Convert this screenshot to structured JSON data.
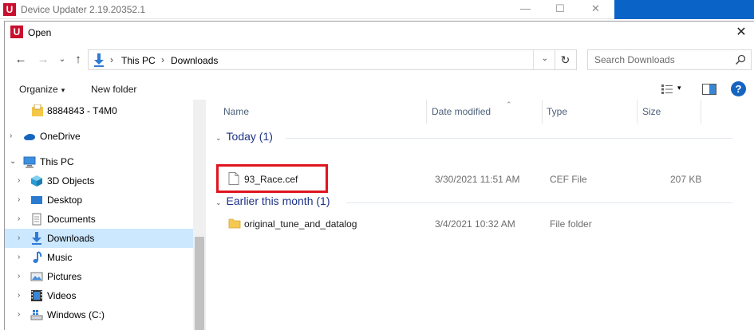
{
  "background_window": {
    "title": "Device Updater 2.19.20352.1",
    "logo_letter": "U",
    "minimize_glyph": "—",
    "maximize_glyph": "☐",
    "close_glyph": "✕"
  },
  "dialog": {
    "title": "Open",
    "logo_letter": "U",
    "close_glyph": "✕"
  },
  "address_bar": {
    "crumbs": [
      "This PC",
      "Downloads"
    ],
    "separator": "›",
    "dropdown_glyph": "⌄",
    "refresh_glyph": "↻"
  },
  "nav_buttons": {
    "back": "←",
    "forward": "→",
    "recent": "⌄",
    "up": "↑"
  },
  "search": {
    "placeholder": "Search Downloads"
  },
  "toolbar": {
    "organize_label": "Organize",
    "caret": "▾",
    "new_folder_label": "New folder",
    "help_label": "?"
  },
  "nav_pane": {
    "items": [
      {
        "label": "8884843 - T4M0",
        "icon": "sticky-folder-icon"
      },
      {
        "label": "OneDrive",
        "icon": "cloud-icon",
        "chevron": "›"
      },
      {
        "label": "This PC",
        "icon": "computer-icon",
        "chevron": "⌄"
      },
      {
        "label": "3D Objects",
        "icon": "cube-icon",
        "chevron": "›"
      },
      {
        "label": "Desktop",
        "icon": "desktop-icon",
        "chevron": "›"
      },
      {
        "label": "Documents",
        "icon": "document-icon",
        "chevron": "›"
      },
      {
        "label": "Downloads",
        "icon": "download-icon",
        "chevron": "›",
        "selected": true
      },
      {
        "label": "Music",
        "icon": "music-icon",
        "chevron": "›"
      },
      {
        "label": "Pictures",
        "icon": "picture-icon",
        "chevron": "›"
      },
      {
        "label": "Videos",
        "icon": "video-icon",
        "chevron": "›"
      },
      {
        "label": "Windows (C:)",
        "icon": "drive-icon",
        "chevron": "›"
      }
    ]
  },
  "columns": {
    "name": "Name",
    "date": "Date modified",
    "type": "Type",
    "size": "Size",
    "sort_glyph": "⌃"
  },
  "groups": [
    {
      "label": "Today (1)",
      "chevron": "⌄"
    },
    {
      "label": "Earlier this month (1)",
      "chevron": "⌄"
    }
  ],
  "files": [
    {
      "name": "93_Race.cef",
      "date": "3/30/2021 11:51 AM",
      "type": "CEF File",
      "size": "207 KB",
      "icon": "file-icon"
    },
    {
      "name": "original_tune_and_datalog",
      "date": "3/4/2021 10:32 AM",
      "type": "File folder",
      "size": "",
      "icon": "folder-icon"
    }
  ],
  "colors": {
    "highlight": "#e0151f",
    "selection": "#cce8ff",
    "group_header": "#1e3287",
    "brand": "#c8102e"
  }
}
